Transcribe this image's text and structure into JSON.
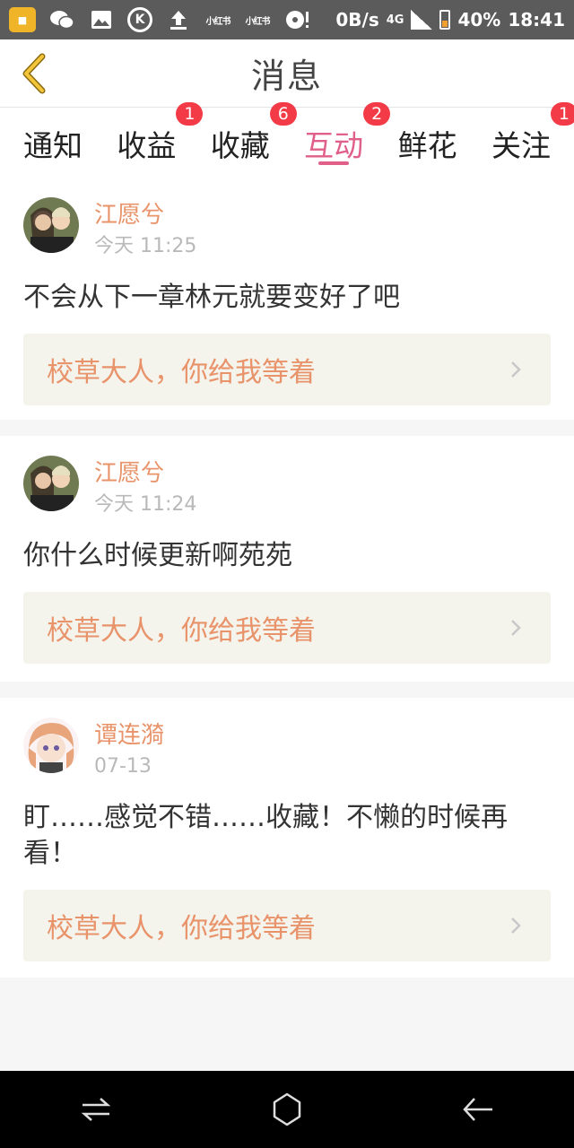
{
  "status_bar": {
    "speed": "0B/s",
    "network": "4G",
    "battery": "40%",
    "time": "18:41",
    "app_label_1": "小红书",
    "app_label_2": "小红书",
    "icons": [
      "message-icon",
      "wechat-icon",
      "image-icon",
      "k-app-icon",
      "upload-icon",
      "xiaohongshu-icon",
      "xiaohongshu-icon",
      "music-icon"
    ]
  },
  "header": {
    "title": "消息"
  },
  "tabs": [
    {
      "label": "通知",
      "badge": "",
      "active": false
    },
    {
      "label": "收益",
      "badge": "1",
      "active": false
    },
    {
      "label": "收藏",
      "badge": "6",
      "active": false
    },
    {
      "label": "互动",
      "badge": "2",
      "active": true
    },
    {
      "label": "鲜花",
      "badge": "",
      "active": false
    },
    {
      "label": "关注",
      "badge": "1",
      "active": false
    }
  ],
  "messages": [
    {
      "username": "江愿兮",
      "time": "今天 11:25",
      "comment": "不会从下一章林元就要变好了吧",
      "ref_title": "校草大人，你给我等着"
    },
    {
      "username": "江愿兮",
      "time": "今天 11:24",
      "comment": "你什么时候更新啊苑苑",
      "ref_title": "校草大人，你给我等着"
    },
    {
      "username": "谭连漪",
      "time": "07-13",
      "comment": "盯……感觉不错……收藏！不懒的时候再看！",
      "ref_title": "校草大人，你给我等着"
    }
  ],
  "colors": {
    "accent": "#e0608a",
    "username": "#e8936a",
    "badge": "#f23b46",
    "ref_background": "#f4f3ec"
  }
}
